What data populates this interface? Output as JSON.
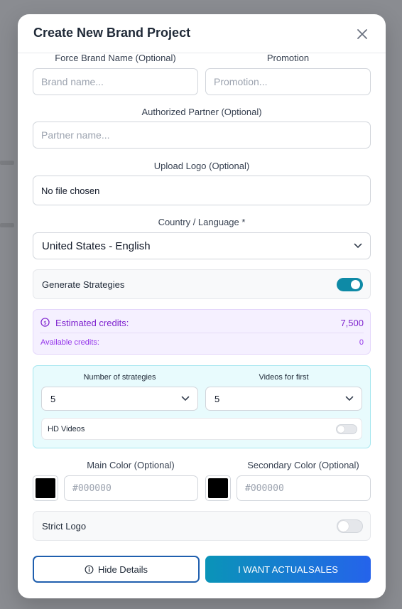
{
  "modal": {
    "title": "Create New Brand Project"
  },
  "brand_name": {
    "label": "Force Brand Name (Optional)",
    "placeholder": "Brand name..."
  },
  "promotion": {
    "label": "Promotion",
    "placeholder": "Promotion..."
  },
  "partner": {
    "label": "Authorized Partner (Optional)",
    "placeholder": "Partner name..."
  },
  "logo": {
    "label": "Upload Logo (Optional)",
    "file_status": "No file chosen"
  },
  "country": {
    "label": "Country / Language *",
    "selected": "United States - English"
  },
  "generate_strategies": {
    "label": "Generate Strategies",
    "enabled": true
  },
  "credits": {
    "estimated_label": "Estimated credits:",
    "estimated_value": "7,500",
    "available_label": "Available credits:",
    "available_value": "0"
  },
  "strategies": {
    "count_label": "Number of strategies",
    "count_value": "5",
    "videos_label": "Videos for first",
    "videos_value": "5",
    "hd_label": "HD Videos",
    "hd_enabled": false
  },
  "main_color": {
    "label": "Main Color (Optional)",
    "placeholder": "#000000",
    "swatch": "#000000"
  },
  "secondary_color": {
    "label": "Secondary Color (Optional)",
    "placeholder": "#000000",
    "swatch": "#000000"
  },
  "strict_logo": {
    "label": "Strict Logo",
    "enabled": false
  },
  "buttons": {
    "hide_details": "Hide Details",
    "submit": "I WANT ACTUALSALES"
  },
  "colors": {
    "accent_toggle": "#0e8aa6",
    "credits_text": "#7e22ce",
    "primary_gradient_start": "#0a94b8",
    "primary_gradient_end": "#2563eb"
  }
}
